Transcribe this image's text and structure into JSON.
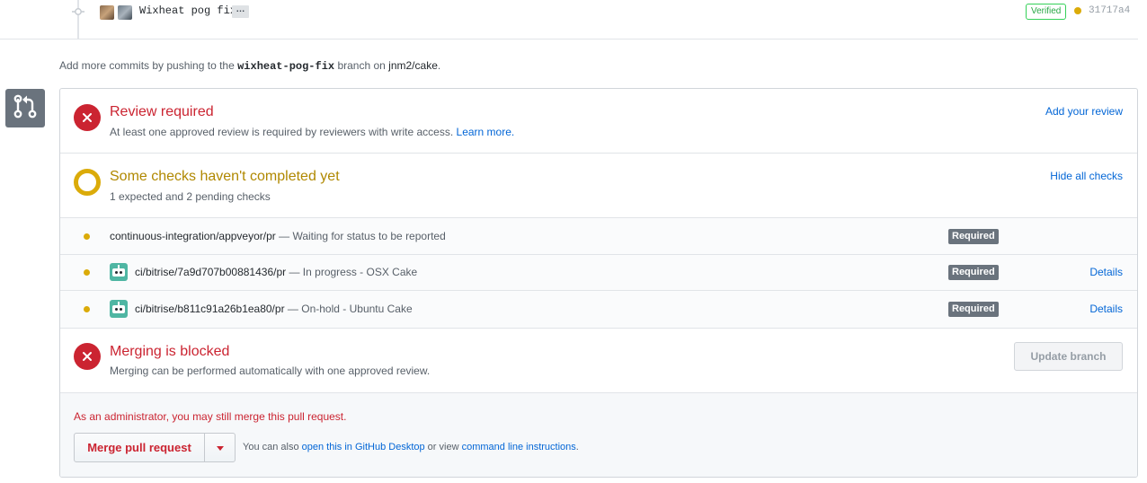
{
  "commit": {
    "message": "Wixheat pog fix",
    "ellipsis": "…",
    "verified": "Verified",
    "sha": "31717a4"
  },
  "push_hint": {
    "prefix": "Add more commits by pushing to the ",
    "branch": "wixheat-pog-fix",
    "middle": " branch on ",
    "repo": "jnm2/cake",
    "suffix": "."
  },
  "review": {
    "title": "Review required",
    "subtitle": "At least one approved review is required by reviewers with write access.",
    "learn_more": "Learn more.",
    "action": "Add your review"
  },
  "checks": {
    "title": "Some checks haven't completed yet",
    "subtitle": "1 expected and 2 pending checks",
    "action": "Hide all checks",
    "items": [
      {
        "name": "continuous-integration/appveyor/pr",
        "status": " — Waiting for status to be reported",
        "badge": "Required",
        "details": ""
      },
      {
        "name": "ci/bitrise/7a9d707b00881436/pr",
        "status": " — In progress - OSX Cake",
        "badge": "Required",
        "details": "Details"
      },
      {
        "name": "ci/bitrise/b811c91a26b1ea80/pr",
        "status": " — On-hold - Ubuntu Cake",
        "badge": "Required",
        "details": "Details"
      }
    ]
  },
  "blocked": {
    "title": "Merging is blocked",
    "subtitle": "Merging can be performed automatically with one approved review.",
    "update_button": "Update branch"
  },
  "admin": {
    "note": "As an administrator, you may still merge this pull request.",
    "merge_button": "Merge pull request",
    "alt_prefix": "You can also ",
    "desktop_link": "open this in GitHub Desktop",
    "alt_middle": " or view ",
    "cli_link": "command line instructions",
    "alt_suffix": "."
  },
  "colors": {
    "error": "#cb2431",
    "pending": "#dbab09",
    "link": "#0366d6",
    "badge": "#6a737d"
  }
}
